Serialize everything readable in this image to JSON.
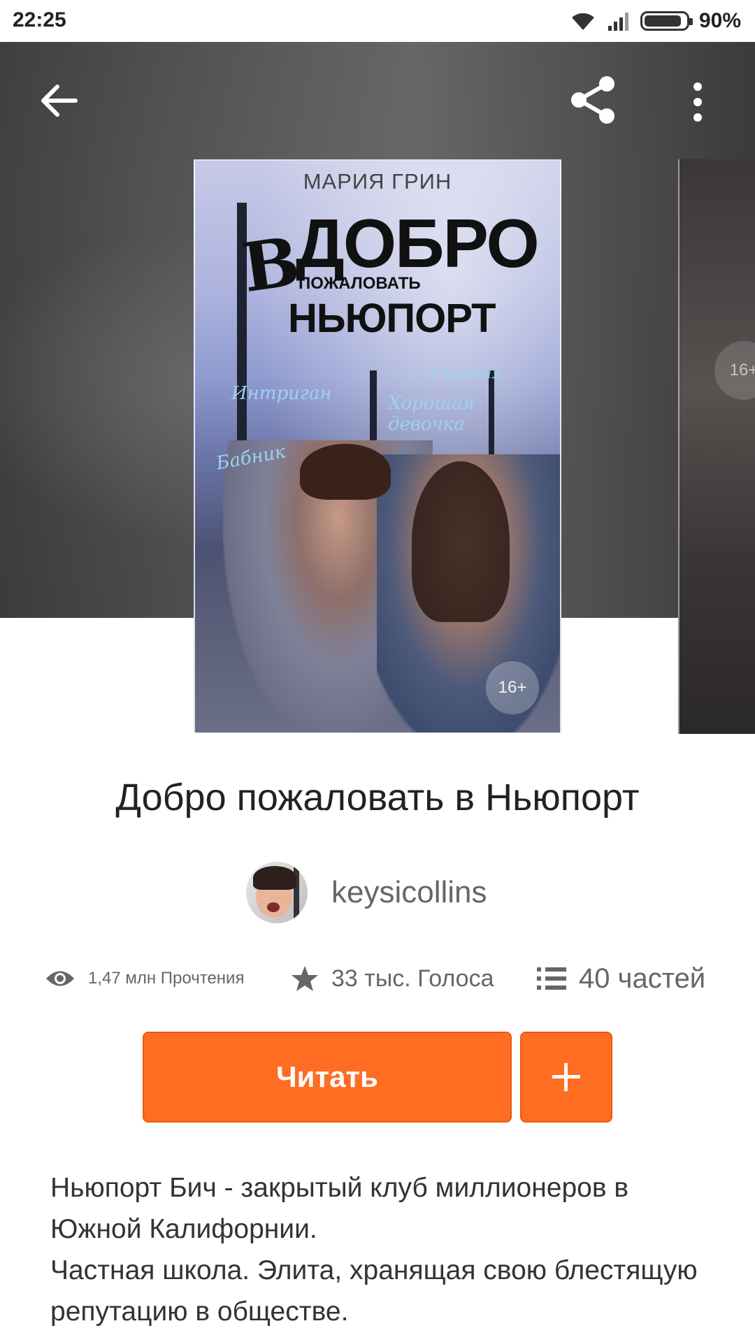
{
  "status_bar": {
    "time": "22:25",
    "battery": "90%",
    "battery_level": 0.9
  },
  "toolbar": {
    "back_icon": "arrow-left-icon",
    "share_icon": "share-icon",
    "more_icon": "more-vertical-icon"
  },
  "cover": {
    "author": "МАРИЯ ГРИН",
    "big_letter": "В",
    "title_line1": "ДОБРО",
    "title_line2": "ПОЖАЛОВАТЬ",
    "title_line3": "НЬЮПОРТ",
    "script_1": "Интриган",
    "script_2": "Хорошая девочка",
    "script_3": "Упрямая",
    "script_4": "Бабник",
    "age_rating": "16+"
  },
  "side_cover": {
    "age_rating": "16+"
  },
  "book": {
    "title": "Добро пожаловать в Ньюпорт",
    "author": "keysicollins"
  },
  "stats": {
    "reads": "1,47 млн Прочтения",
    "votes": "33 тыс. Голоса",
    "parts": "40 частей"
  },
  "actions": {
    "read_label": "Читать",
    "add_label": "+"
  },
  "description": {
    "line1": "Ньюпорт Бич - закрытый клуб миллионеров в Южной Калифорнии.",
    "line2": "Частная школа. Элита, хранящая свою блестящую репутацию в обществе."
  },
  "colors": {
    "accent": "#ff6d22",
    "text": "#222222",
    "muted": "#666666"
  }
}
